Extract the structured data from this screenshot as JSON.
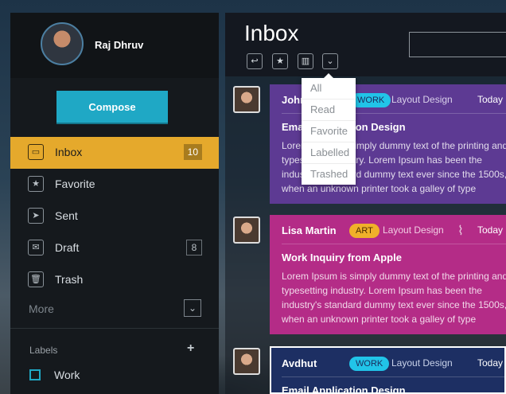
{
  "user": {
    "name": "Raj Dhruv"
  },
  "compose_label": "Compose",
  "nav": [
    {
      "label": "Inbox",
      "count": "10",
      "icon": "inbox-icon",
      "glyph": "▭"
    },
    {
      "label": "Favorite",
      "count": "",
      "icon": "star-icon",
      "glyph": "★"
    },
    {
      "label": "Sent",
      "count": "",
      "icon": "send-icon",
      "glyph": "➤"
    },
    {
      "label": "Draft",
      "count": "8",
      "icon": "draft-icon",
      "glyph": "✉"
    },
    {
      "label": "Trash",
      "count": "",
      "icon": "trash-icon",
      "glyph": "🗑"
    }
  ],
  "more_label": "More",
  "labels": {
    "heading": "Labels",
    "items": [
      {
        "label": "Work"
      }
    ]
  },
  "main": {
    "title": "Inbox"
  },
  "dropdown": [
    "All",
    "Read",
    "Favorite",
    "Labelled",
    "Trashed"
  ],
  "mails": [
    {
      "sender": "John",
      "tag": "WORK",
      "category": "Layout Design",
      "date": "Today",
      "subject": "Email Application Design",
      "body": "Lorem Ipsum is simply dummy text of the printing and typesetting industry. Lorem Ipsum has been the industry's standard dummy text ever since the 1500s, when an unknown printer took a galley of type",
      "color": "#5d3a93",
      "tag_color": "#21c4e8"
    },
    {
      "sender": "Lisa Martin",
      "tag": "ART",
      "category": "Layout Design",
      "date": "Today",
      "subject": "Work Inquiry from Apple",
      "body": "Lorem Ipsum is simply dummy text of the printing and typesetting industry. Lorem Ipsum has been the industry's standard dummy text ever since the 1500s, when an unknown printer took a galley of type",
      "color": "#b42c87",
      "tag_color": "#f0b02a"
    },
    {
      "sender": "Avdhut",
      "tag": "WORK",
      "category": "Layout Design",
      "date": "Today",
      "subject": "Email Application Design",
      "body": "",
      "color": "#1d2f63",
      "tag_color": "#21c4e8"
    }
  ]
}
